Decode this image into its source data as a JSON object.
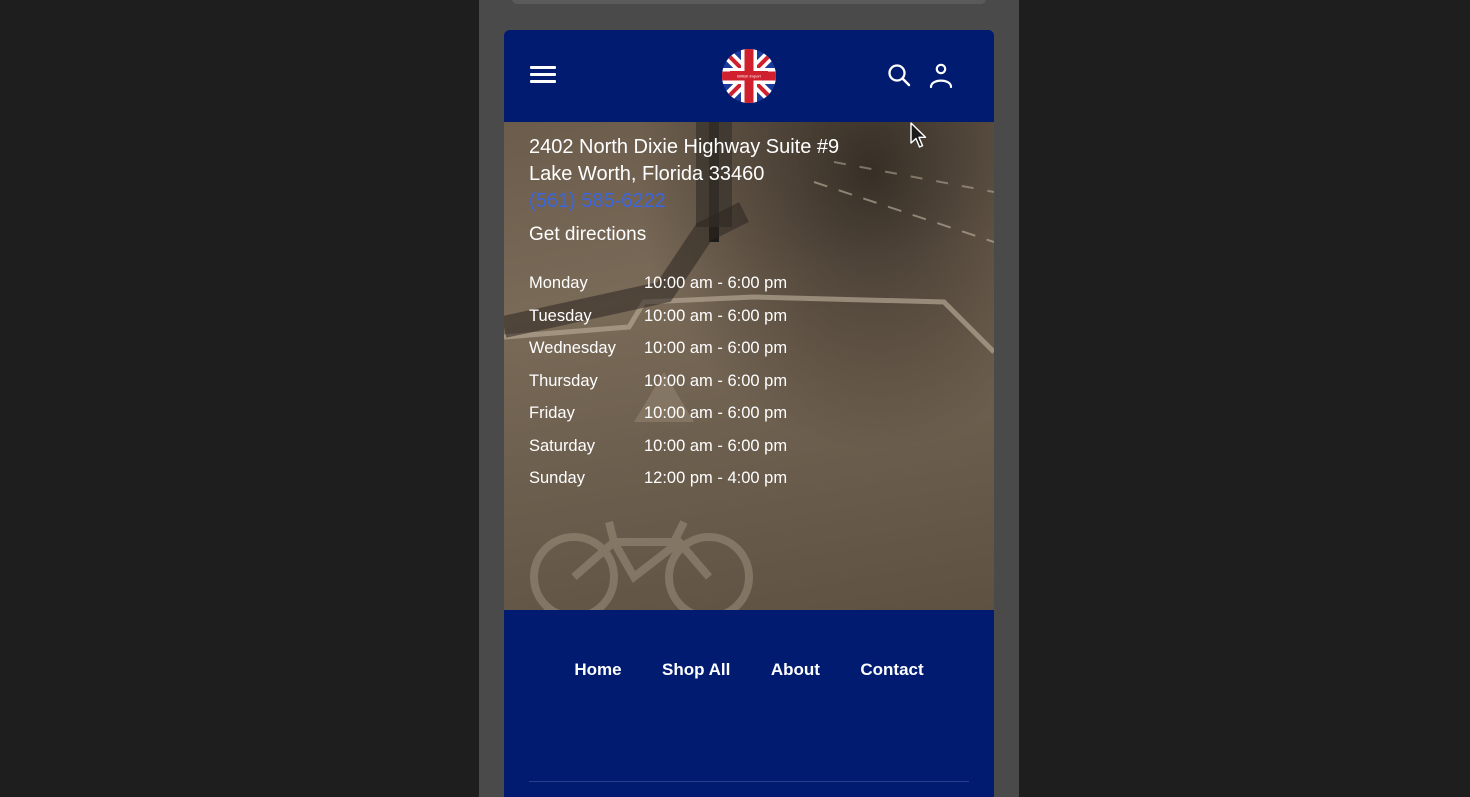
{
  "header": {
    "logo_text": "British Import",
    "colors": {
      "navy": "#001b70",
      "flag_red": "#d0202e",
      "white": "#ffffff"
    },
    "icons": [
      "hamburger-menu-icon",
      "search-icon",
      "account-icon"
    ]
  },
  "location": {
    "address_line1": "2402 North Dixie Highway Suite #9",
    "address_line2": "Lake Worth, Florida 33460",
    "phone": "(561) 585-6222",
    "directions_label": "Get directions"
  },
  "hours": [
    {
      "day": "Monday",
      "time": "10:00 am - 6:00 pm"
    },
    {
      "day": "Tuesday",
      "time": "10:00 am - 6:00 pm"
    },
    {
      "day": "Wednesday",
      "time": "10:00 am - 6:00 pm"
    },
    {
      "day": "Thursday",
      "time": "10:00 am - 6:00 pm"
    },
    {
      "day": "Friday",
      "time": "10:00 am - 6:00 pm"
    },
    {
      "day": "Saturday",
      "time": "10:00 am - 6:00 pm"
    },
    {
      "day": "Sunday",
      "time": "12:00 pm - 4:00 pm"
    }
  ],
  "footer": {
    "nav": [
      "Home",
      "Shop All",
      "About",
      "Contact"
    ]
  }
}
